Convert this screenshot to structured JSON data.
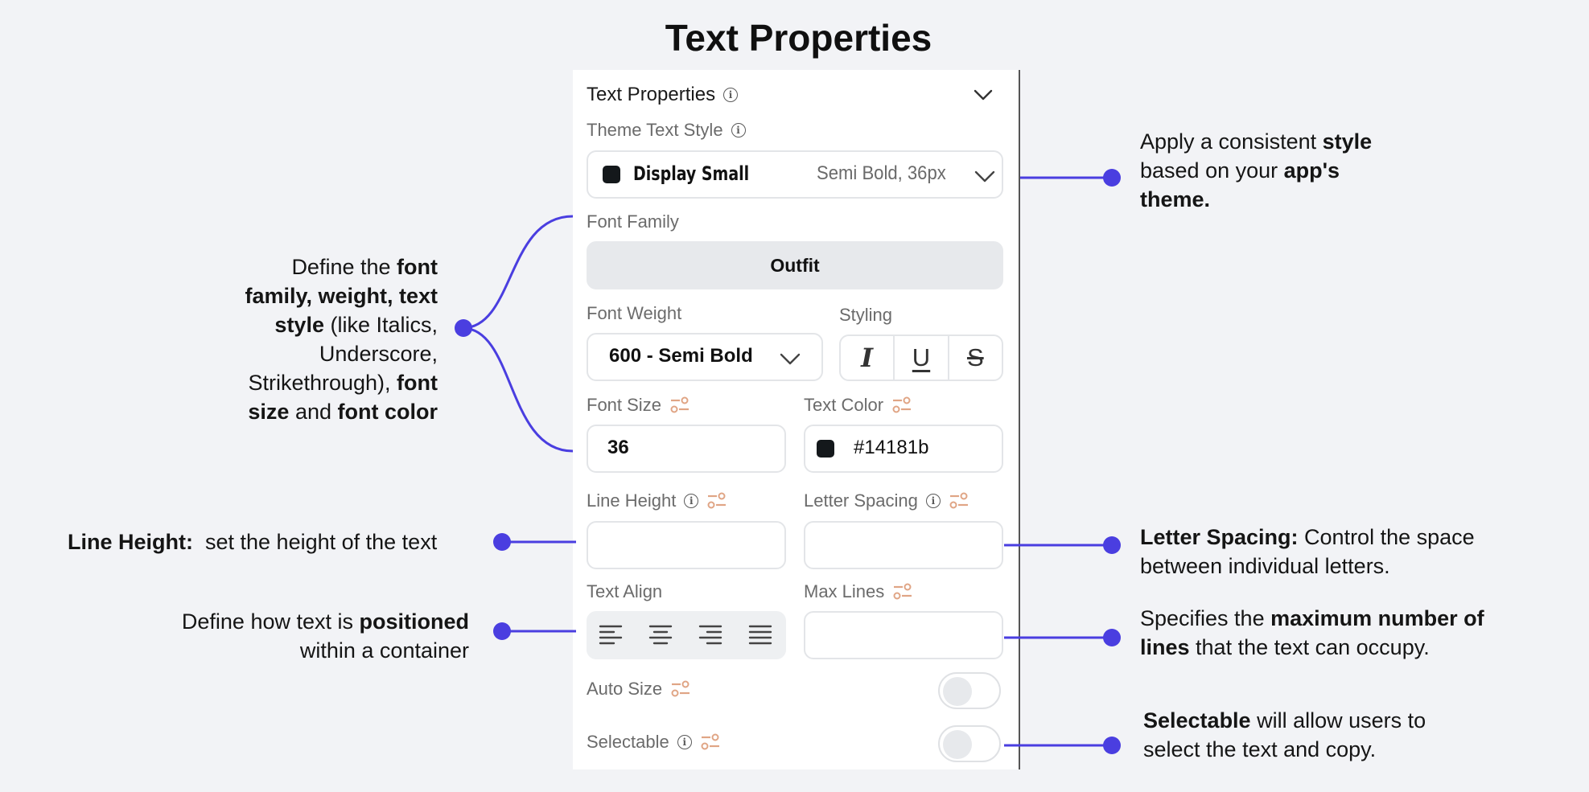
{
  "page_title": "Text Properties",
  "panel": {
    "header": {
      "title": "Text Properties",
      "info_icon": "info-icon",
      "collapse_icon": "chevron-down-icon"
    },
    "theme_text_style": {
      "label": "Theme Text Style",
      "value_name": "Display Small",
      "value_detail": "Semi Bold, 36px",
      "swatch_color": "#14181b"
    },
    "font_family": {
      "label": "Font Family",
      "value": "Outfit"
    },
    "font_weight": {
      "label": "Font Weight",
      "value": "600 - Semi Bold"
    },
    "styling": {
      "label": "Styling",
      "italic": "I",
      "underline": "U",
      "strikethrough": "S"
    },
    "font_size": {
      "label": "Font Size",
      "value": "36"
    },
    "text_color": {
      "label": "Text Color",
      "value": "#14181b",
      "swatch_color": "#14181b"
    },
    "line_height": {
      "label": "Line Height",
      "value": ""
    },
    "letter_spacing": {
      "label": "Letter Spacing",
      "value": ""
    },
    "text_align": {
      "label": "Text Align",
      "options": [
        "left",
        "center",
        "right",
        "justify"
      ]
    },
    "max_lines": {
      "label": "Max Lines",
      "value": ""
    },
    "auto_size": {
      "label": "Auto Size",
      "enabled": false
    },
    "selectable": {
      "label": "Selectable",
      "enabled": false
    }
  },
  "annotations": {
    "theme": {
      "l1_pre": "Apply a consistent ",
      "l1_bold": "style",
      "l2_pre": "based on your ",
      "l2_bold": "app's",
      "l3_bold": "theme."
    },
    "font": {
      "l1_pre": "Define the ",
      "l1_bold": "font",
      "l2_bold": "family, weight, text",
      "l3_bold": "style",
      "l3_post": " (like Italics,",
      "l4": "Underscore,",
      "l5_pre": "Strikethrough), ",
      "l5_bold": "font",
      "l6_bold1": "size",
      "l6_mid": " and ",
      "l6_bold2": "font color"
    },
    "line_height": {
      "bold": "Line Height:",
      "post": "  set the height of the text"
    },
    "letter_spacing": {
      "bold": "Letter Spacing:",
      "post": " Control the space",
      "l2": "between individual letters."
    },
    "align": {
      "l1_pre": "Define how text is ",
      "l1_bold": "positioned",
      "l2": "within a container"
    },
    "max_lines": {
      "l1_pre": "Specifies the ",
      "l1_bold": "maximum number of",
      "l2_bold": "lines",
      "l2_post": " that the text can occupy."
    },
    "selectable": {
      "l1_bold": "Selectable",
      "l1_post": " will allow users to",
      "l2": "select the text and copy."
    }
  },
  "colors": {
    "accent": "#4a3ee0",
    "setting_icon": "#e0a585",
    "panel_bg": "#ffffff",
    "page_bg": "#f2f3f6"
  }
}
